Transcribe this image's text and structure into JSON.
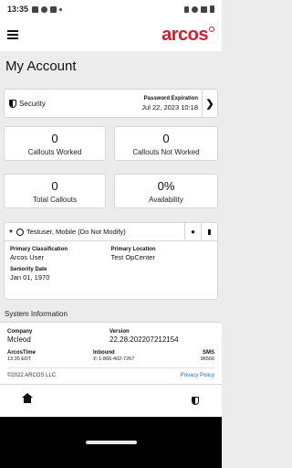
{
  "status_bar": {
    "time": "13:35",
    "icons": [
      "mail-icon",
      "media-icon",
      "mail-icon",
      "dot-icon"
    ],
    "right_icons": [
      "vibrate-icon",
      "wifi-icon",
      "signal-icon",
      "battery-icon"
    ]
  },
  "app_bar": {
    "menu_icon": "hamburger-menu-icon",
    "logo_text": "arcos",
    "logo_color": "#d0202f"
  },
  "page": {
    "title": "My Account"
  },
  "security": {
    "label": "Security",
    "icon": "shield-icon",
    "password_expiration_label": "Password Expiration",
    "password_expiration_value": "Jul 22, 2023 10:18",
    "chevron_icon": "chevron-right-icon"
  },
  "stats": [
    {
      "value": "0",
      "label": "Callouts Worked"
    },
    {
      "value": "0",
      "label": "Callouts Not Worked"
    },
    {
      "value": "0",
      "label": "Total Callouts"
    },
    {
      "value": "0%",
      "label": "Availability"
    }
  ],
  "user": {
    "name": "Testuser, Mobile (Do Not Modify)",
    "caret_icon": "caret-down-icon",
    "person_icon": "person-icon",
    "location_icon": "location-pin-icon",
    "mic_icon": "microphone-icon",
    "fields": [
      {
        "label": "Primary Classification",
        "value": "Arcos User"
      },
      {
        "label": "Primary Location",
        "value": "Test OpCenter"
      },
      {
        "label": "Seniority Date",
        "value": "Jan 01, 1970"
      }
    ]
  },
  "system": {
    "title": "System Information",
    "company_label": "Company",
    "company_value": "Mcleod",
    "version_label": "Version",
    "version_value": "22.28.202207212154",
    "arcos_time_label": "ArcosTime",
    "arcos_time_value": "13:35 EDT",
    "inbound_label": "Inbound",
    "inbound_value": "1-866-402-7267",
    "phone_icon": "phone-icon",
    "sms_label": "SMS",
    "sms_value": "96566",
    "copyright": "©2022 ARCOS LLC",
    "privacy_link": "Privacy Policy"
  },
  "bottom_nav": {
    "home_icon": "home-icon",
    "shield_icon": "shield-icon"
  },
  "colors": {
    "accent": "#d0202f",
    "link": "#1a6fcf",
    "background": "#ececec"
  }
}
